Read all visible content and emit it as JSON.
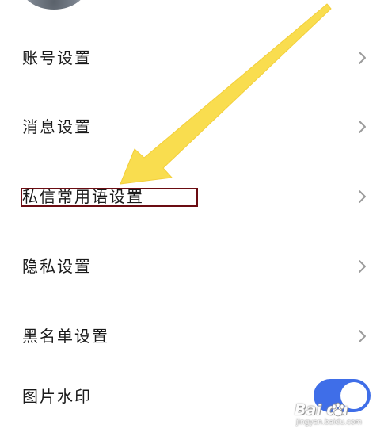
{
  "settings": {
    "items": [
      {
        "label": "账号设置"
      },
      {
        "label": "消息设置"
      },
      {
        "label": "私信常用语设置"
      },
      {
        "label": "隐私设置"
      },
      {
        "label": "黑名单设置"
      },
      {
        "label": "图片水印"
      }
    ]
  },
  "watermark_toggle": {
    "state": "on",
    "color": "#3f6ee8"
  },
  "annotations": {
    "arrow_color": "#f9dd4f",
    "highlight_color": "#6b0c12"
  },
  "baidu_watermark": {
    "main": "Bai du",
    "sub": "jingyan.baidu.com"
  },
  "icons": {
    "row_chevron": "chevron-right-icon",
    "watermark_logo": "baidu-paw-icon"
  }
}
